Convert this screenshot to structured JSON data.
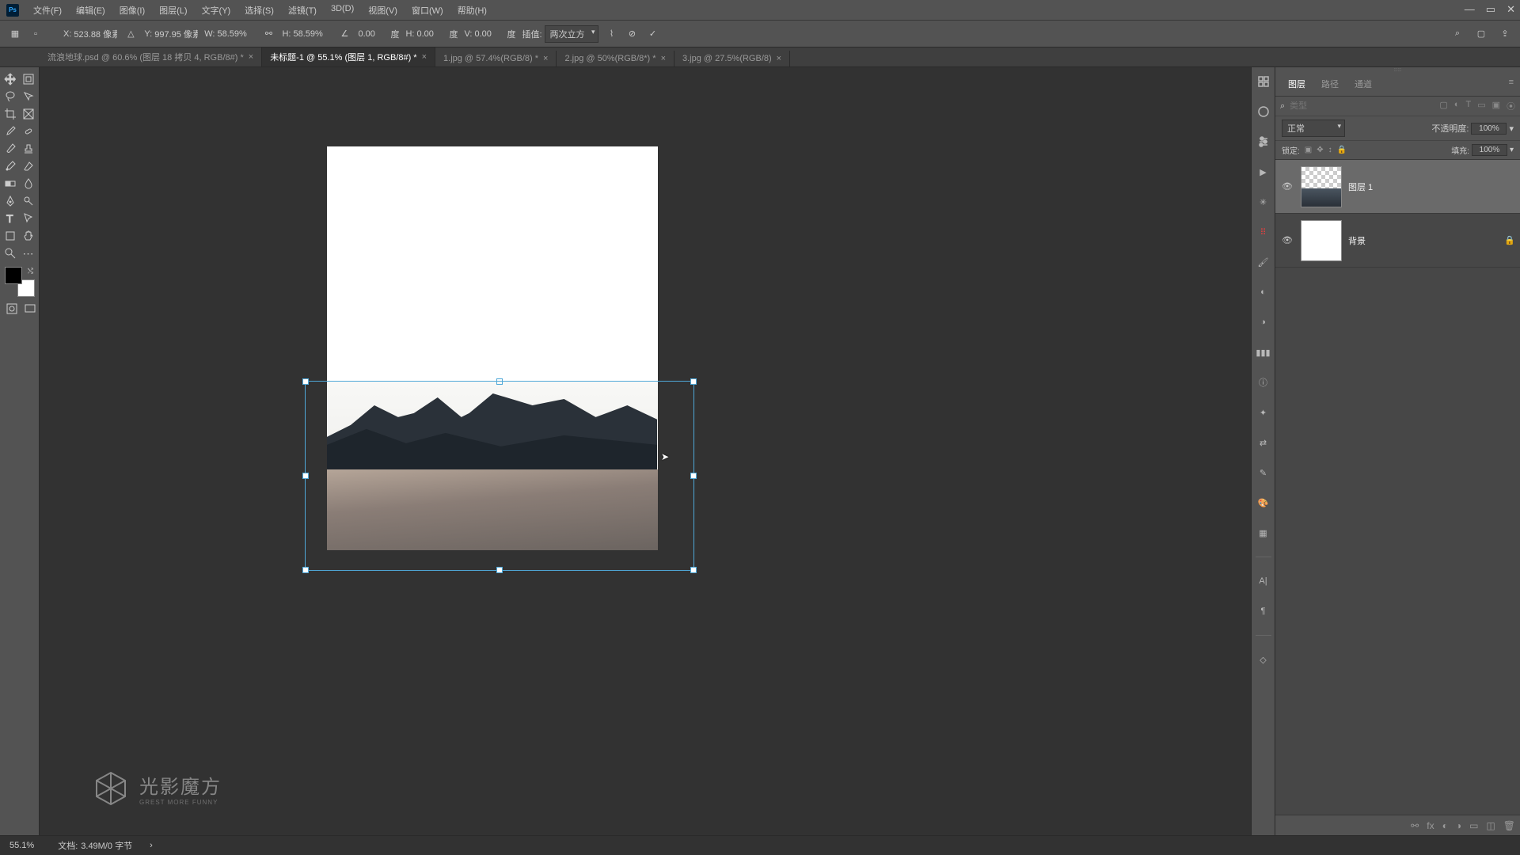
{
  "menu": {
    "file": "文件(F)",
    "edit": "编辑(E)",
    "image": "图像(I)",
    "layer": "图层(L)",
    "type": "文字(Y)",
    "select": "选择(S)",
    "filter": "滤镜(T)",
    "threeD": "3D(D)",
    "view": "视图(V)",
    "window": "窗口(W)",
    "help": "帮助(H)"
  },
  "options": {
    "x_label": "X:",
    "x_val": "523.88 像素",
    "y_label": "Y:",
    "y_val": "997.95 像素",
    "w_label": "W:",
    "w_val": "58.59%",
    "h_label": "H:",
    "h_val": "58.59%",
    "rot_label": "",
    "rot_val": "0.00",
    "rot_unit": "度",
    "skewH_label": "H:",
    "skewH_val": "0.00",
    "skewH_unit": "度",
    "skewV_label": "V:",
    "skewV_val": "0.00",
    "skewV_unit": "度",
    "interp_label": "插值:",
    "interp_val": "两次立方"
  },
  "tabs": [
    {
      "label": "流浪地球.psd @ 60.6% (图层 18 拷贝 4, RGB/8#) *",
      "active": false
    },
    {
      "label": "未标题-1 @ 55.1% (图层 1, RGB/8#) *",
      "active": true
    },
    {
      "label": "1.jpg @ 57.4%(RGB/8) *",
      "active": false
    },
    {
      "label": "2.jpg @ 50%(RGB/8*) *",
      "active": false
    },
    {
      "label": "3.jpg @ 27.5%(RGB/8) ",
      "active": false
    }
  ],
  "panels": {
    "tab_layers": "图层",
    "tab_paths": "路径",
    "tab_channels": "通道",
    "search_placeholder": "类型",
    "blend_mode": "正常",
    "opacity_label": "不透明度:",
    "opacity_val": "100%",
    "lock_label": "锁定:",
    "fill_label": "填充:",
    "fill_val": "100%",
    "layers": [
      {
        "name": "图层 1",
        "selected": true,
        "locked": false,
        "thumb": "image"
      },
      {
        "name": "背景",
        "selected": false,
        "locked": true,
        "thumb": "white"
      }
    ]
  },
  "status": {
    "zoom": "55.1%",
    "doc_label": "文档:",
    "doc_info": "3.49M/0 字节"
  },
  "watermark": {
    "main": "光影魔方",
    "sub": "GREST MORE FUNNY"
  }
}
